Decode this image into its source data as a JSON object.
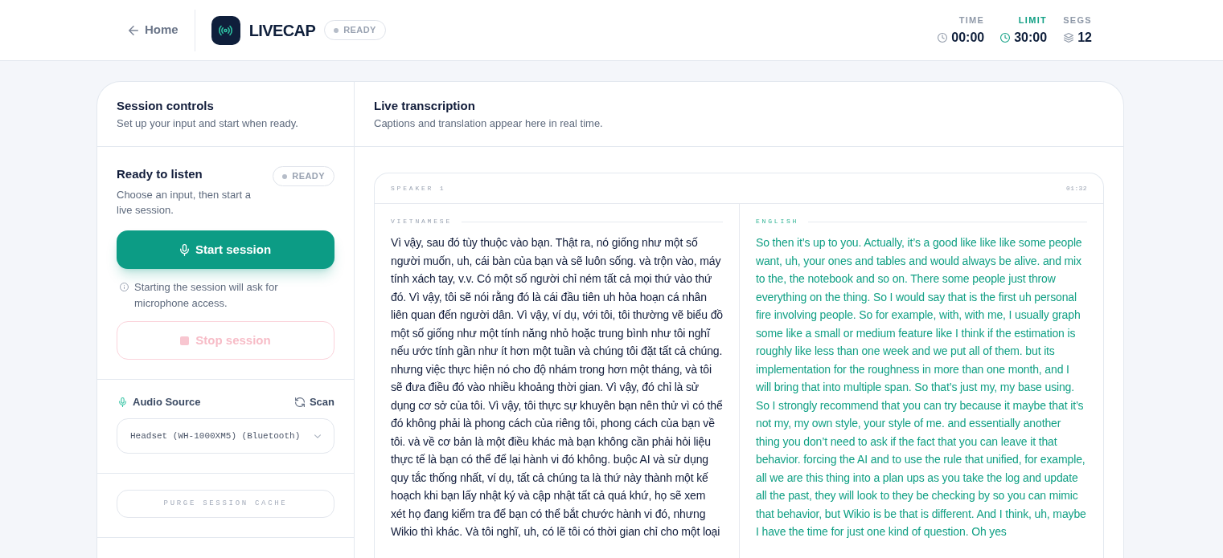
{
  "header": {
    "back_link": "Home",
    "app_name": "LIVECAP",
    "status_badge": "READY",
    "stats": [
      {
        "label": "TIME",
        "value": "00:00",
        "kind": "time",
        "highlighted": false
      },
      {
        "label": "LIMIT",
        "value": "30:00",
        "kind": "time",
        "highlighted": true
      },
      {
        "label": "SEGS",
        "value": "12",
        "kind": "count",
        "highlighted": false
      }
    ]
  },
  "session_controls": {
    "title": "Session controls",
    "subtitle": "Set up your input and start when ready.",
    "status": {
      "title": "Ready to listen",
      "badge": "READY",
      "description": "Choose an input, then start a live session."
    },
    "start_button": {
      "label": "Start session",
      "disabled": false
    },
    "notice": "Starting the session will ask for microphone access.",
    "stop_button": {
      "label": "Stop session",
      "disabled": true
    },
    "audio_source": {
      "label": "Audio Source",
      "scan_button": "Scan",
      "device": "Headset (WH-1000XM5) (Bluetooth)"
    },
    "purge_button": "PURGE SESSION CACHE"
  },
  "transcription": {
    "title": "Live transcription",
    "subtitle": "Captions and translation appear here in real time.",
    "segments": [
      {
        "speaker": "SPEAKER 1",
        "time": "01:32",
        "source": {
          "language": "VIETNAMESE",
          "text": "Vì vậy, sau đó tùy thuộc vào bạn. Thật ra, nó giống như một số người muốn, uh, cái bàn của bạn và sẽ luôn sống. và trộn vào, máy tính xách tay, v.v. Có một số người chỉ ném tất cả mọi thứ vào thứ đó. Vì vậy, tôi sẽ nói rằng đó là cái đầu tiên uh hỏa hoạn cá nhân liên quan đến người dân. Vì vậy, ví dụ, với tôi, tôi thường vẽ biểu đồ một số giống như một tính năng nhỏ hoặc trung bình như tôi nghĩ nếu ước tính gần như ít hơn một tuần và chúng tôi đặt tất cả chúng. nhưng việc thực hiện nó cho độ nhám trong hơn một tháng, và tôi sẽ đưa điều đó vào nhiều khoảng thời gian. Vì vậy, đó chỉ là sử dụng cơ sở của tôi. Vì vậy, tôi thực sự khuyên bạn nên thử vì có thể đó không phải là phong cách của riêng tôi, phong cách của bạn về tôi. và về cơ bản là một điều khác mà bạn không cần phải hỏi liệu thực tế là bạn có thể để lại hành vi đó không. buộc AI và sử dụng quy tắc thống nhất, ví dụ, tất cả chúng ta là thứ này thành một kế hoạch khi bạn lấy nhật ký và cập nhật tất cả quá khứ, họ sẽ xem xét họ đang kiểm tra để bạn có thể bắt chước hành vi đó, nhưng Wikio thì khác. Và tôi nghĩ, uh, có lẽ tôi có thời gian chỉ cho một loại"
        },
        "translation": {
          "language": "ENGLISH",
          "text": "So then it’s up to you. Actually, it’s a good like like like some people want, uh, your ones and tables and would always be alive. and mix to the, the notebook and so on. There some people just throw everything on the thing. So I would say that is the first uh personal fire involving people. So for example, with, with me, I usually graph some like a small or medium feature like I think if the estimation is roughly like less than one week and we put all of them. but its implementation for the roughness in more than one month, and I will bring that into multiple span. So that’s just my, my base using. So I strongly recommend that you can try because it maybe that it’s not my, my own style, your style of me. and essentially another thing you don’t need to ask if the fact that you can leave it that behavior. forcing the AI and to use the rule that unified, for example, all we are this thing into a plan ups as you take the log and update all the past, they will look to they be checking by so you can mimic that behavior, but Wikio is be that is different. And I think, uh, maybe I have the time for just one kind of question. Oh yes"
        }
      }
    ]
  }
}
